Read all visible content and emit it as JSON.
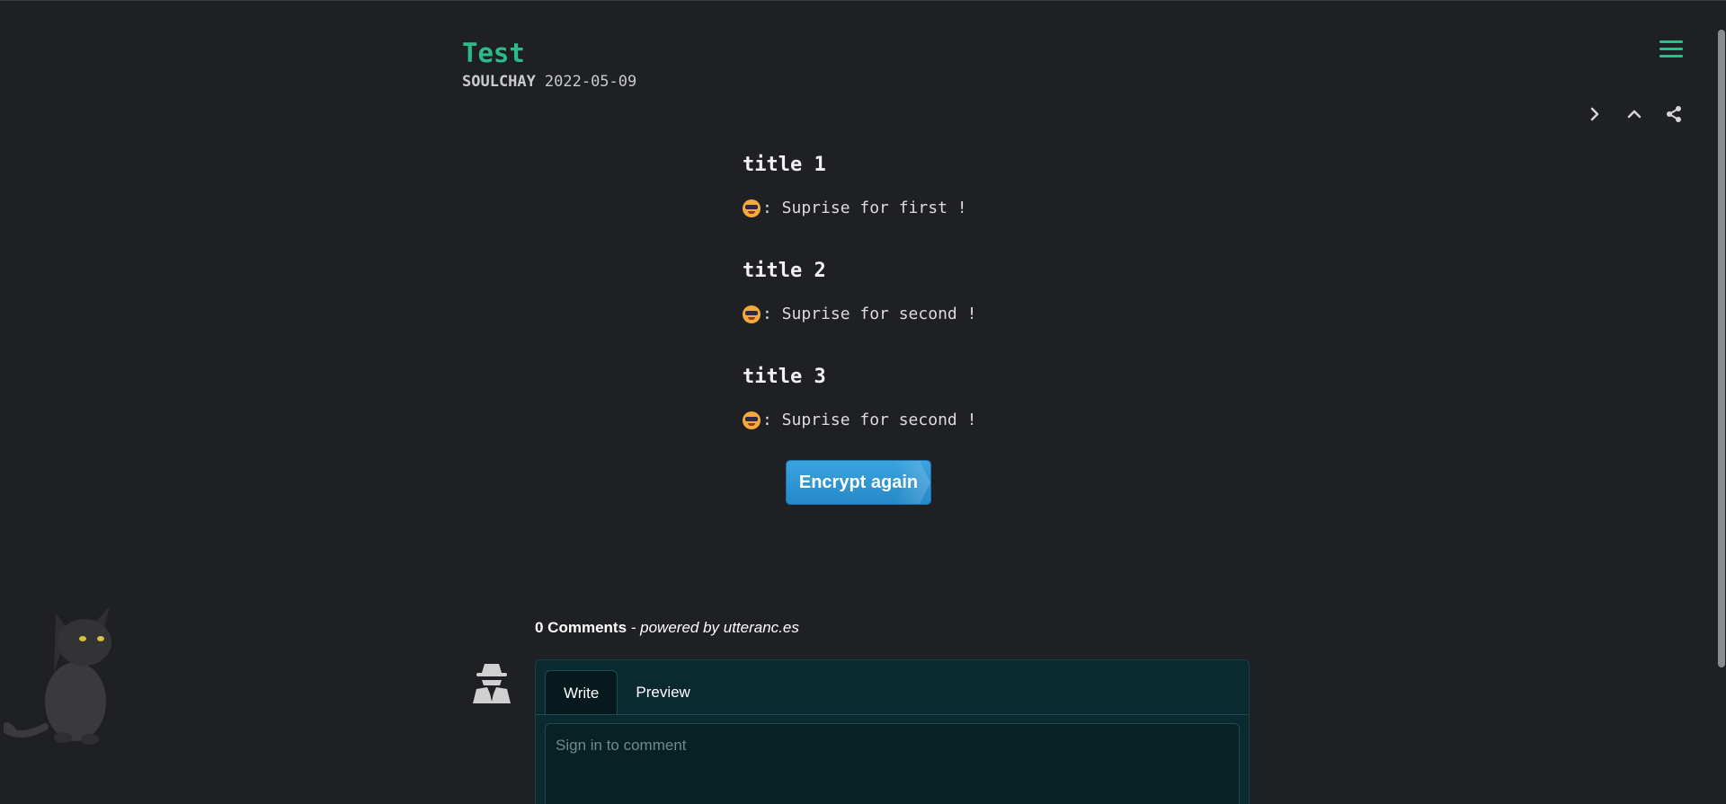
{
  "post": {
    "title": "Test",
    "author": "SOULCHAY",
    "date": "2022-05-09"
  },
  "nav": {
    "menu_icon": "hamburger-icon",
    "actions": [
      {
        "icon": "chevron-right-icon"
      },
      {
        "icon": "chevron-up-icon"
      },
      {
        "icon": "share-icon"
      }
    ]
  },
  "content": {
    "sections": [
      {
        "title": "title 1",
        "text": ": Suprise for first !"
      },
      {
        "title": "title 2",
        "text": ": Suprise for second !"
      },
      {
        "title": "title 3",
        "text": ": Suprise for second !"
      }
    ],
    "encrypt_button": "Encrypt again"
  },
  "comments": {
    "count_label": "0 Comments",
    "powered_by": " - powered by utteranc.es",
    "tabs": [
      "Write",
      "Preview"
    ],
    "placeholder": "Sign in to comment"
  },
  "colors": {
    "accent": "#2bbc8a",
    "background": "#1f2023",
    "button": "#2f95d4",
    "comment_bg": "#0b2a30"
  }
}
